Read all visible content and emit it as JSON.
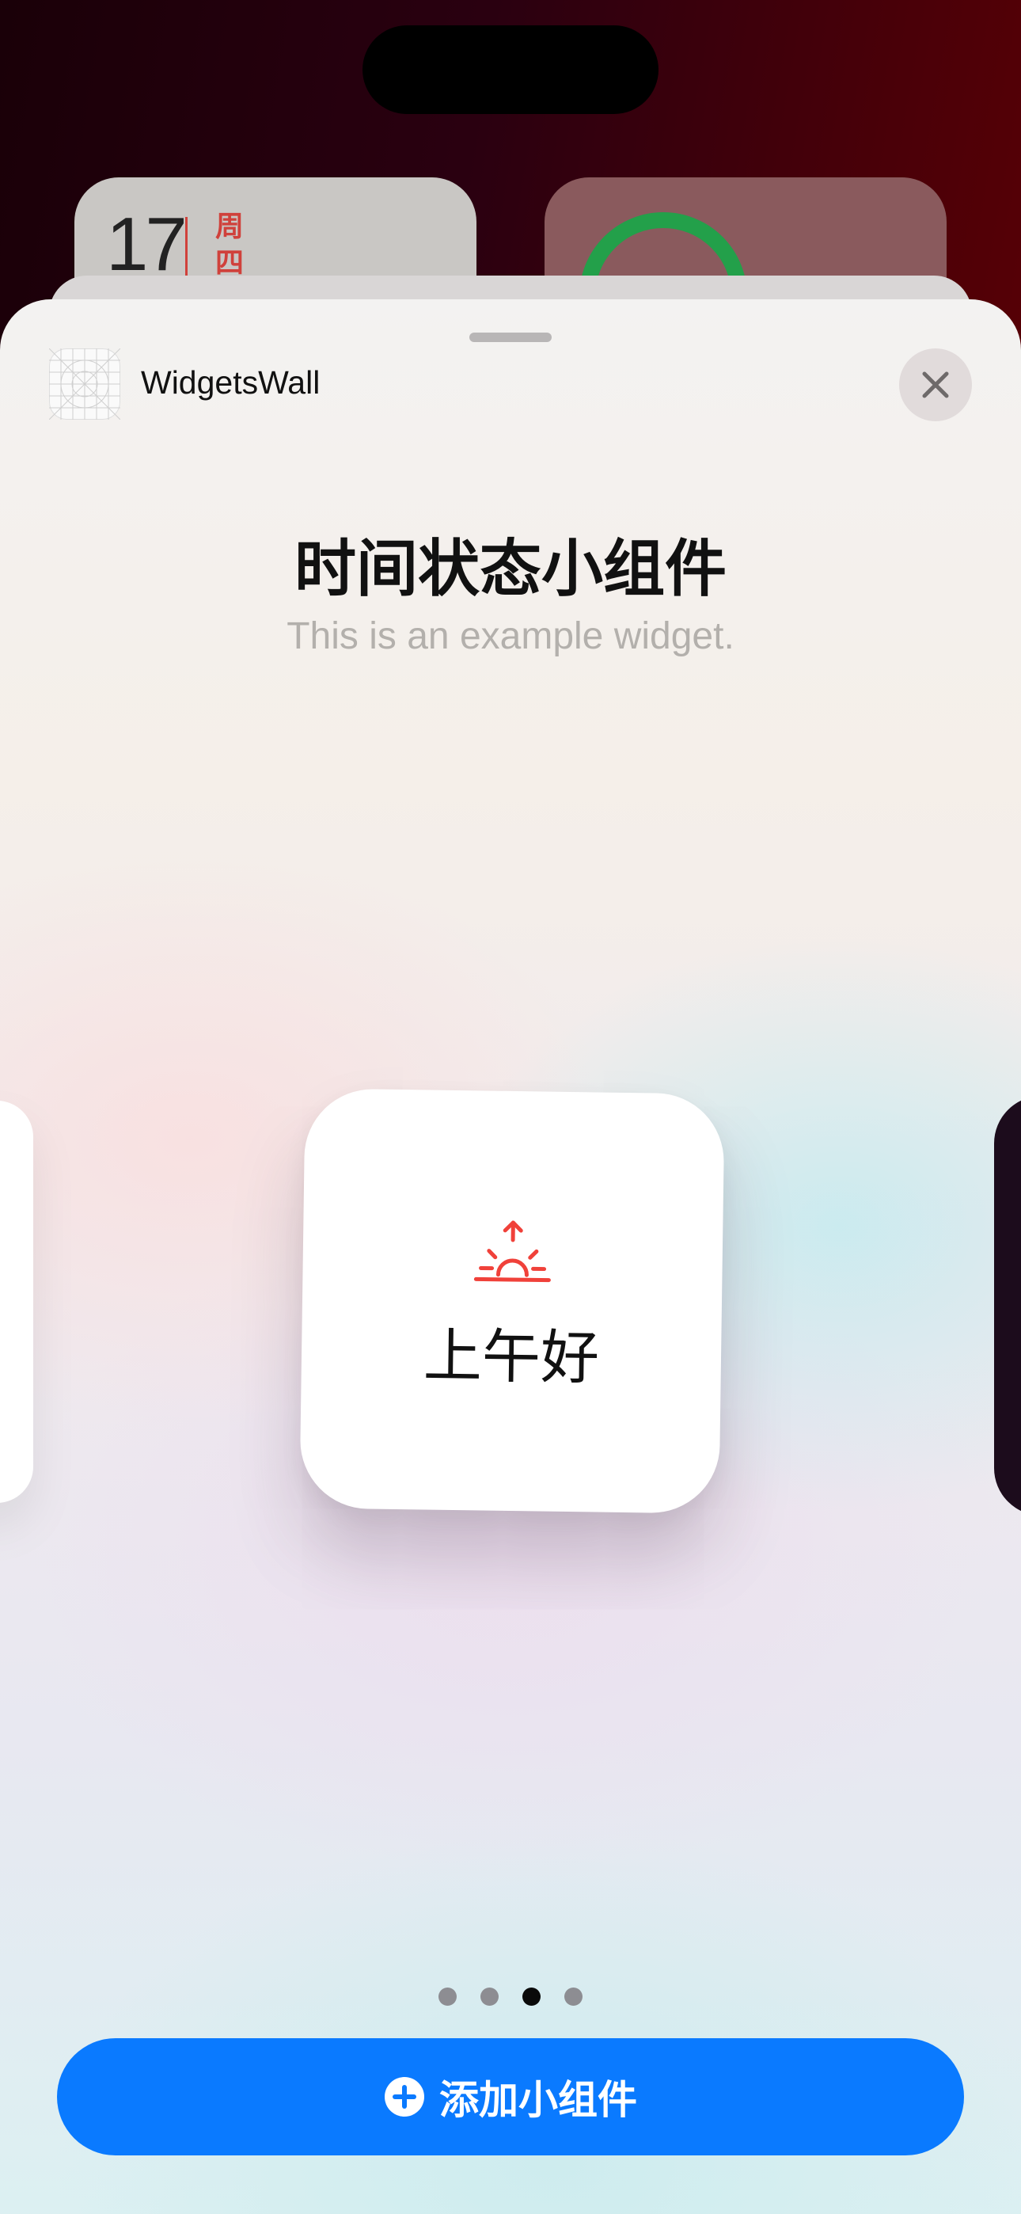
{
  "homescreen": {
    "calendar_day_number": "17",
    "calendar_weekday": "周四"
  },
  "sheet": {
    "app_name": "WidgetsWall",
    "widget_title": "时间状态小组件",
    "widget_description": "This is an example widget.",
    "widget_preview": {
      "icon": "sunrise-icon",
      "greeting": "上午好",
      "icon_color": "#f0413a"
    },
    "page_dots": {
      "count": 4,
      "active_index": 2
    },
    "add_button_label": "添加小组件",
    "add_button_icon": "plus-circle-icon",
    "accent_color": "#0a7aff"
  }
}
